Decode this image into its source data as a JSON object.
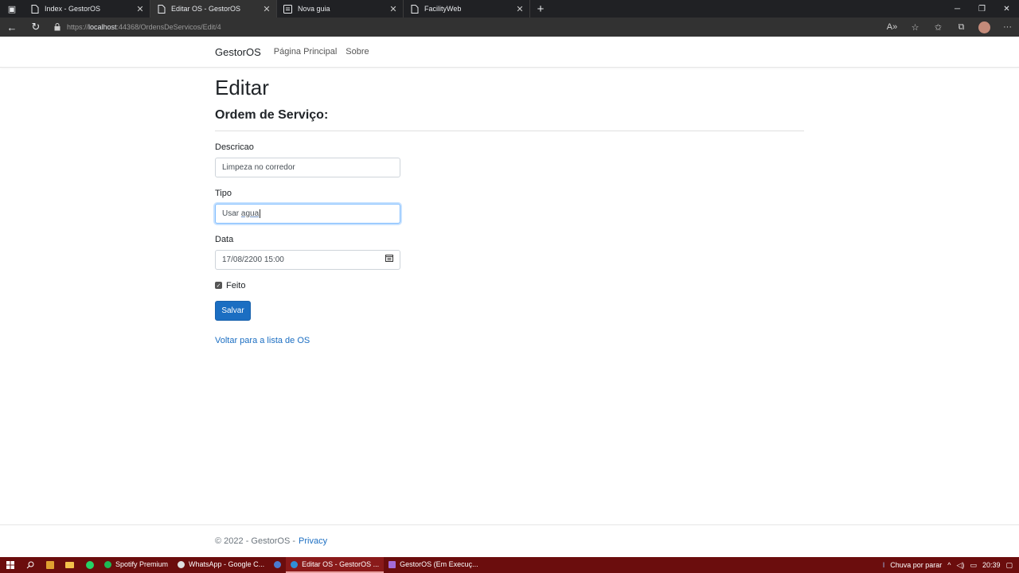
{
  "browser": {
    "tabs": [
      {
        "title": "Index - GestorOS",
        "active": false,
        "icon": "page-icon"
      },
      {
        "title": "Editar OS - GestorOS",
        "active": true,
        "icon": "page-icon"
      },
      {
        "title": "Nova guia",
        "active": false,
        "icon": "newtab-page-icon"
      },
      {
        "title": "FacilityWeb",
        "active": false,
        "icon": "page-icon"
      }
    ],
    "url_prefix": "https://",
    "url_host": "localhost",
    "url_rest": ":44368/OrdensDeServicos/Edit/4"
  },
  "navbar": {
    "brand": "GestorOS",
    "links": [
      "Página Principal",
      "Sobre"
    ]
  },
  "main": {
    "title": "Editar",
    "subtitle": "Ordem de Serviço:",
    "fields": {
      "descricao": {
        "label": "Descricao",
        "value": "Limpeza no corredor"
      },
      "tipo": {
        "label": "Tipo",
        "value_plain": "Usar ",
        "value_underlined": "agua"
      },
      "data": {
        "label": "Data",
        "value": "17/08/2200 15:00"
      },
      "feito": {
        "label": "Feito",
        "checked": true
      }
    },
    "save_label": "Salvar",
    "back_link": "Voltar para a lista de OS"
  },
  "footer": {
    "text": "© 2022 - GestorOS -",
    "privacy": "Privacy"
  },
  "taskbar": {
    "apps": [
      {
        "label": "Spotify Premium",
        "color": "#1db954",
        "active": false
      },
      {
        "label": "WhatsApp - Google C...",
        "color": "#e0e0e0",
        "active": false
      },
      {
        "label": "",
        "color": "#4a7bd0",
        "active": false
      },
      {
        "label": "Editar OS - GestorOS ...",
        "color": "#2f8fd8",
        "active": true
      },
      {
        "label": "GestorOS (Em Execuç...",
        "color": "#a46bd6",
        "active": false
      }
    ],
    "weather": "Chuva por parar",
    "time": "20:39"
  },
  "colors": {
    "accent": "#1b6ec2",
    "taskbar": "#6b0d0d"
  }
}
